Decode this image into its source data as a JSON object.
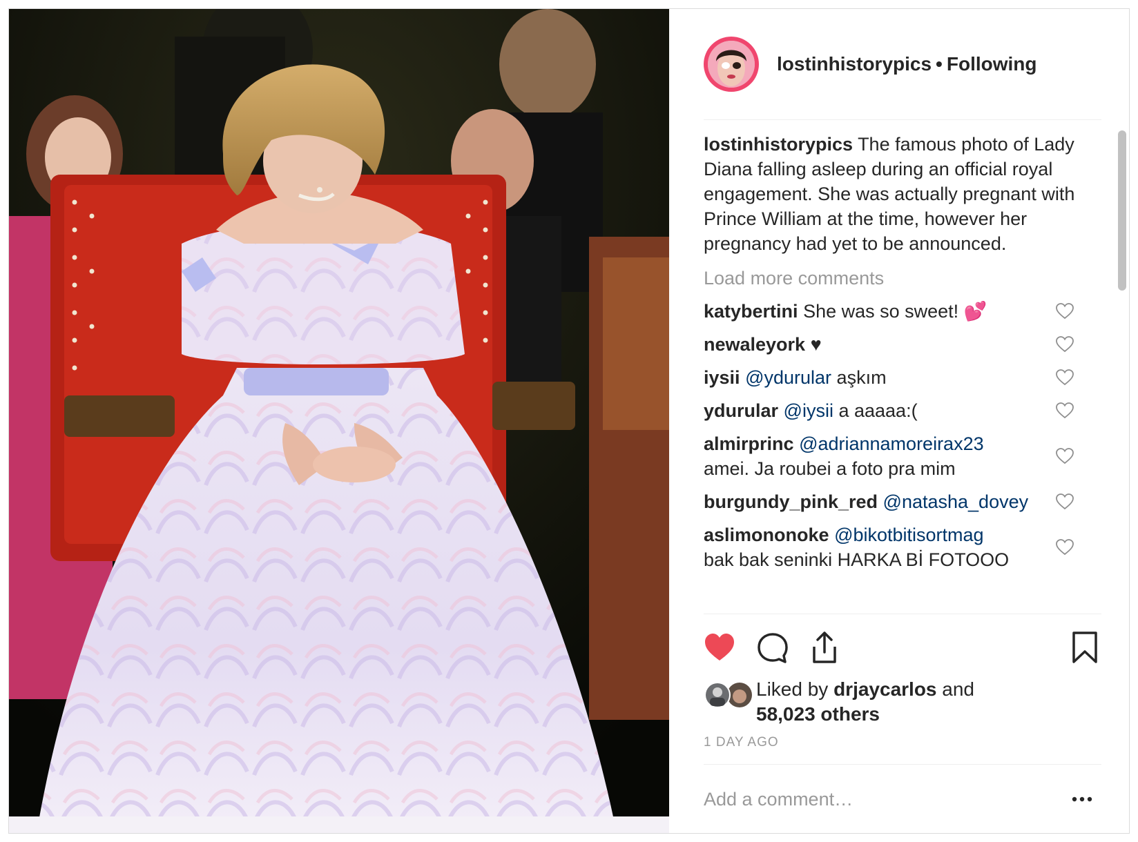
{
  "colors": {
    "accent_like": "#ed4956",
    "mention": "#003569",
    "muted": "#999999",
    "text": "#262626",
    "avatar_ring": "#f0466e"
  },
  "photo": {
    "subject": "woman in off-shoulder lavender gown asleep in red chair"
  },
  "header": {
    "username": "lostinhistorypics",
    "separator": "•",
    "follow_status": "Following"
  },
  "caption": {
    "username": "lostinhistorypics",
    "text": "The famous photo of Lady Diana falling asleep during an official royal engagement. She was actually pregnant with Prince William at the time, however her pregnancy had yet to be announced."
  },
  "load_more": "Load more comments",
  "comments": [
    {
      "username": "katybertini",
      "mention": "",
      "text": "She was so sweet! 💕"
    },
    {
      "username": "newaleyork",
      "mention": "",
      "text": "♥"
    },
    {
      "username": "iysii",
      "mention": "@ydurular",
      "text": "aşkım"
    },
    {
      "username": "ydurular",
      "mention": "@iysii",
      "text": "a aaaaa:("
    },
    {
      "username": "almirprinc",
      "mention": "@adriannamoreirax23",
      "text": "amei. Ja roubei a foto pra mim"
    },
    {
      "username": "burgundy_pink_red",
      "mention": "@natasha_dovey",
      "text": ""
    },
    {
      "username": "aslimononoke",
      "mention": "@bikotbitisortmag",
      "text": "bak bak seninki HARKA Bİ FOTOOO"
    }
  ],
  "icons": {
    "like": "heart-filled-icon",
    "comment": "comment-bubble-icon",
    "share": "share-upload-icon",
    "save": "bookmark-icon",
    "comment_like": "heart-outline-icon",
    "more": "ellipsis-icon"
  },
  "likes": {
    "prefix": "Liked by",
    "first_user": "drjaycarlos",
    "middle": "and",
    "others": "58,023 others"
  },
  "timestamp": "1 DAY AGO",
  "add_comment": {
    "placeholder": "Add a comment…"
  }
}
